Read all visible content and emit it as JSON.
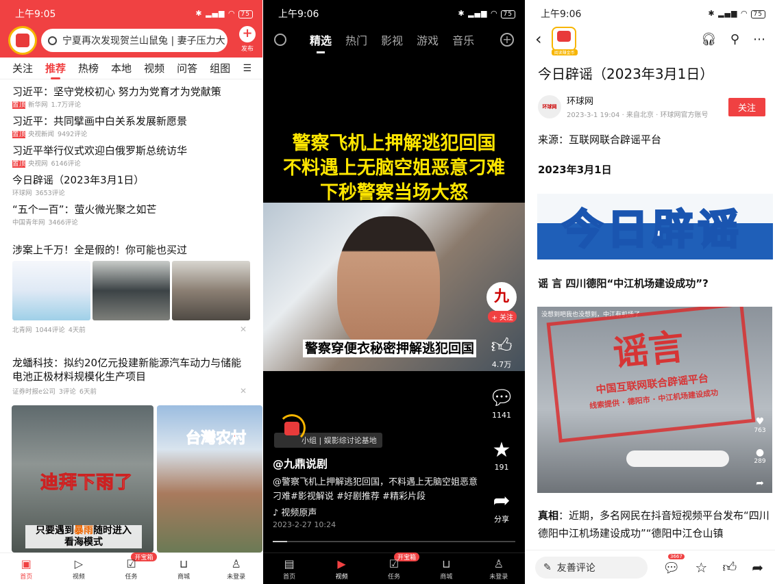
{
  "p1": {
    "time": "上午9:05",
    "battery": "75",
    "search": "宁夏再次发现贺兰山鼠兔 | 妻子压力大",
    "publish": "发布",
    "tabs": [
      "关注",
      "推荐",
      "热榜",
      "本地",
      "视频",
      "问答",
      "组图"
    ],
    "news": [
      {
        "title": "习近平：坚守党校初心 努力为党育才为党献策",
        "top": "置顶",
        "source": "新华网",
        "comments": "1.7万评论"
      },
      {
        "title": "习近平：共同擘画中白关系发展新愿景",
        "top": "置顶",
        "source": "央视新闻",
        "comments": "9492评论"
      },
      {
        "title": "习近平举行仪式欢迎白俄罗斯总统访华",
        "top": "置顶",
        "source": "央视网",
        "comments": "6146评论"
      },
      {
        "title": "今日辟谣（2023年3月1日）",
        "top": "",
        "source": "环球网",
        "comments": "3653评论"
      },
      {
        "title": "“五个一百”：萤火微光聚之如芒",
        "top": "",
        "source": "中国青年网",
        "comments": "3466评论"
      }
    ],
    "article2": {
      "title": "涉案上千万！全是假的！你可能也买过",
      "source": "北青网",
      "comments": "1044评论",
      "time": "4天前"
    },
    "article3": {
      "title": "龙蟠科技：拟约20亿元投建新能源汽车动力与储能电池正极材料规模化生产项目",
      "source": "证券时报e公司",
      "comments": "3评论",
      "time": "6天前"
    },
    "gallery": {
      "cap1": "迪拜下雨了",
      "cap2a": "只要遇到",
      "cap2b": "暴雨",
      "cap2c": "随时进入",
      "cap2d": "看海模式",
      "cap3": "台灣农村"
    },
    "nav": [
      "首页",
      "视频",
      "任务",
      "商城",
      "未登录"
    ],
    "badge": "开宝箱"
  },
  "p2": {
    "time": "上午9:06",
    "battery": "75",
    "tabs": [
      "精选",
      "热门",
      "影视",
      "游戏",
      "音乐"
    ],
    "headline": [
      "警察飞机上押解逃犯回国",
      "不料遇上无脑空姐恶意刁难",
      "下秒警察当场大怒"
    ],
    "subtitle": "警察穿便衣秘密押解逃犯回国",
    "avatar": "九",
    "follow": "+ 关注",
    "likes": "4.7万",
    "comments": "1141",
    "favs": "191",
    "share": "分享",
    "tag": "小组 | 娱影综讨论基地",
    "author": "@九鼎说剧",
    "desc": "@警察飞机上押解逃犯回国，不料遇上无脑空姐恶意刁难#影视解说 #好剧推荐 #精彩片段",
    "music": "♪ 视频原声",
    "date": "2023-2-27 10:24",
    "nav": [
      "首页",
      "视频",
      "任务",
      "商城",
      "未登录"
    ],
    "badge": "开宝箱"
  },
  "p3": {
    "time": "上午9:06",
    "battery": "75",
    "logo_badge": "阅读赚金币",
    "title": "今日辟谣（2023年3月1日）",
    "src_name": "环球网",
    "src_av": "环球网",
    "src_meta": "2023-3-1 19:04 · 来自北京 · 环球网官方账号",
    "follow": "关注",
    "source_line": "来源：互联网联合辟谣平台",
    "date_line": "2023年3月1日",
    "banner": "今日辟谣",
    "rumor": "谣 言 四川德阳“中江机场建设成功”?",
    "img_cap": "没想到吧我也没想到，中江有机场了",
    "stamp_big": "谣言",
    "stamp_small": "中国互联网联合辟谣平台",
    "stamp_line": "线索提供 · 德阳市 · 中江机场建设成功",
    "likes": "763",
    "comments": "289",
    "truth_label": "真相",
    "truth_text": "：近期，多名网民在抖音短视频平台发布“四川德阳中江机场建设成功”“德阳中江仓山镇",
    "comment_placeholder": "友善评论",
    "comment_count": "3667"
  }
}
